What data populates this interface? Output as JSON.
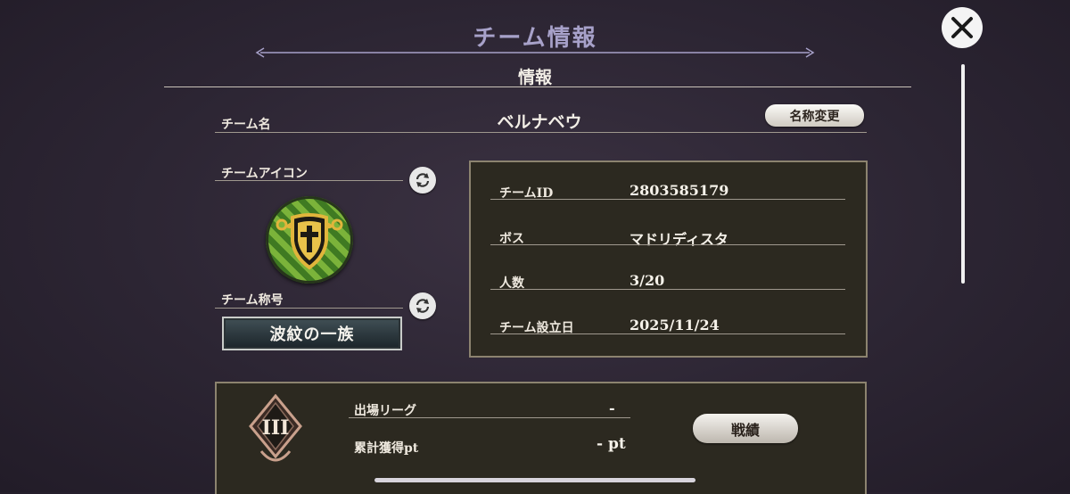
{
  "header": {
    "title": "チーム情報",
    "section_title": "情報"
  },
  "team": {
    "name_label": "チーム名",
    "name_value": "ベルナベウ",
    "rename_button": "名称変更",
    "icon_label": "チームアイコン",
    "title_label": "チーム称号",
    "title_value": "波紋の一族"
  },
  "info": {
    "rows": [
      {
        "label": "チームID",
        "value": "2803585179"
      },
      {
        "label": "ボス",
        "value": "マドリディスタ"
      },
      {
        "label": "人数",
        "value": "3/20"
      },
      {
        "label": "チーム設立日",
        "value": "2025/11/24"
      }
    ]
  },
  "league": {
    "rank_numeral": "III",
    "league_label": "出場リーグ",
    "league_value": "-",
    "points_label": "累計獲得pt",
    "points_value": "- pt",
    "record_button": "戦績"
  },
  "icons": {
    "close": "close-icon",
    "refresh": "refresh-icon",
    "emblem": "shield-cross-emblem-icon",
    "rank_badge": "rank-badge-icon"
  },
  "colors": {
    "title_color": "#a7a1c9",
    "panel_bg": "#2c2920",
    "panel_border": "#8c836f",
    "emblem_green": "#4e8d2a",
    "emblem_gold": "#e1b53b"
  }
}
